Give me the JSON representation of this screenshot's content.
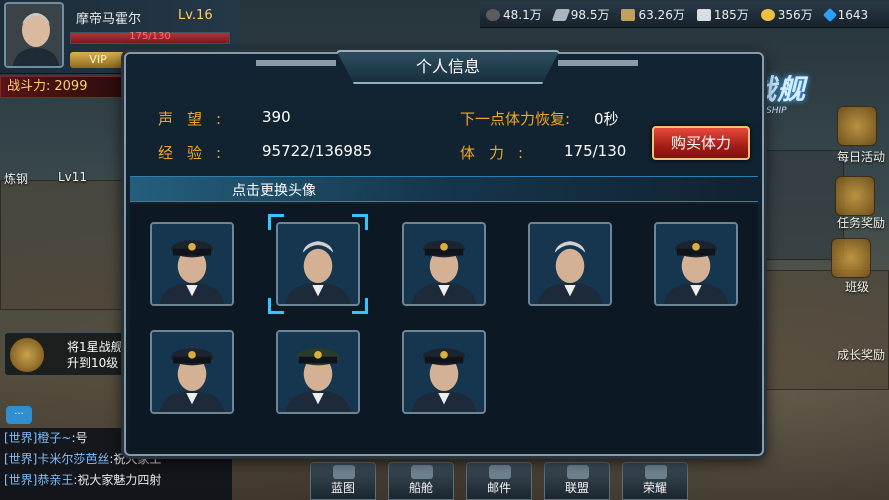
{
  "player": {
    "name": "摩帝马霍尔",
    "level": "Lv.16",
    "xp": "175/130",
    "vip": "VIP",
    "combat_label": "战斗力:",
    "combat_value": "2099"
  },
  "resources": [
    {
      "icon": "oil-icon",
      "value": "48.1万"
    },
    {
      "icon": "steel-icon",
      "value": "98.5万"
    },
    {
      "icon": "ammo-icon",
      "value": "63.26万"
    },
    {
      "icon": "aluminum-icon",
      "value": "185万"
    },
    {
      "icon": "gold-icon",
      "value": "356万"
    },
    {
      "icon": "gem-icon",
      "value": "1643"
    }
  ],
  "logo": {
    "main": "暴风战舰",
    "sub": "STORM WARSHIP"
  },
  "side_menu": {
    "daily": "每日活动",
    "task_reward": "任务奖励",
    "rank": "班级",
    "growth": "成长奖励"
  },
  "left": {
    "refine": "炼钢",
    "refine_level": "Lv11",
    "task": "将1星战舰升到10级"
  },
  "chat": [
    {
      "channel": "[世界]",
      "who": "橙子~",
      "text": ":号"
    },
    {
      "channel": "[世界]",
      "who": "卡米尔莎芭丝",
      "text": ":祝大家工"
    },
    {
      "channel": "[世界]",
      "who": "恭亲王",
      "text": ":祝大家魅力四射"
    }
  ],
  "bottom_nav": [
    "蓝图",
    "船舱",
    "邮件",
    "联盟",
    "荣耀"
  ],
  "modal": {
    "title": "个人信息",
    "reputation_label": "声望:",
    "reputation_value": "390",
    "exp_label": "经验:",
    "exp_value": "95722/136985",
    "recover_label": "下一点体力恢复:",
    "recover_value": "0秒",
    "stamina_label": "体力:",
    "stamina_value": "175/130",
    "buy_button": "购买体力",
    "section_title": "点击更换头像",
    "portraits": [
      {
        "name": "portrait-admiral-1",
        "selected": false,
        "cap": "dark"
      },
      {
        "name": "portrait-admiral-2",
        "selected": true,
        "cap": "none"
      },
      {
        "name": "portrait-admiral-3",
        "selected": false,
        "cap": "dark"
      },
      {
        "name": "portrait-admiral-4",
        "selected": false,
        "cap": "none"
      },
      {
        "name": "portrait-admiral-5",
        "selected": false,
        "cap": "dark"
      },
      {
        "name": "portrait-admiral-6",
        "selected": false,
        "cap": "dark"
      },
      {
        "name": "portrait-admiral-7",
        "selected": false,
        "cap": "khaki"
      },
      {
        "name": "portrait-admiral-8",
        "selected": false,
        "cap": "dark"
      }
    ]
  }
}
